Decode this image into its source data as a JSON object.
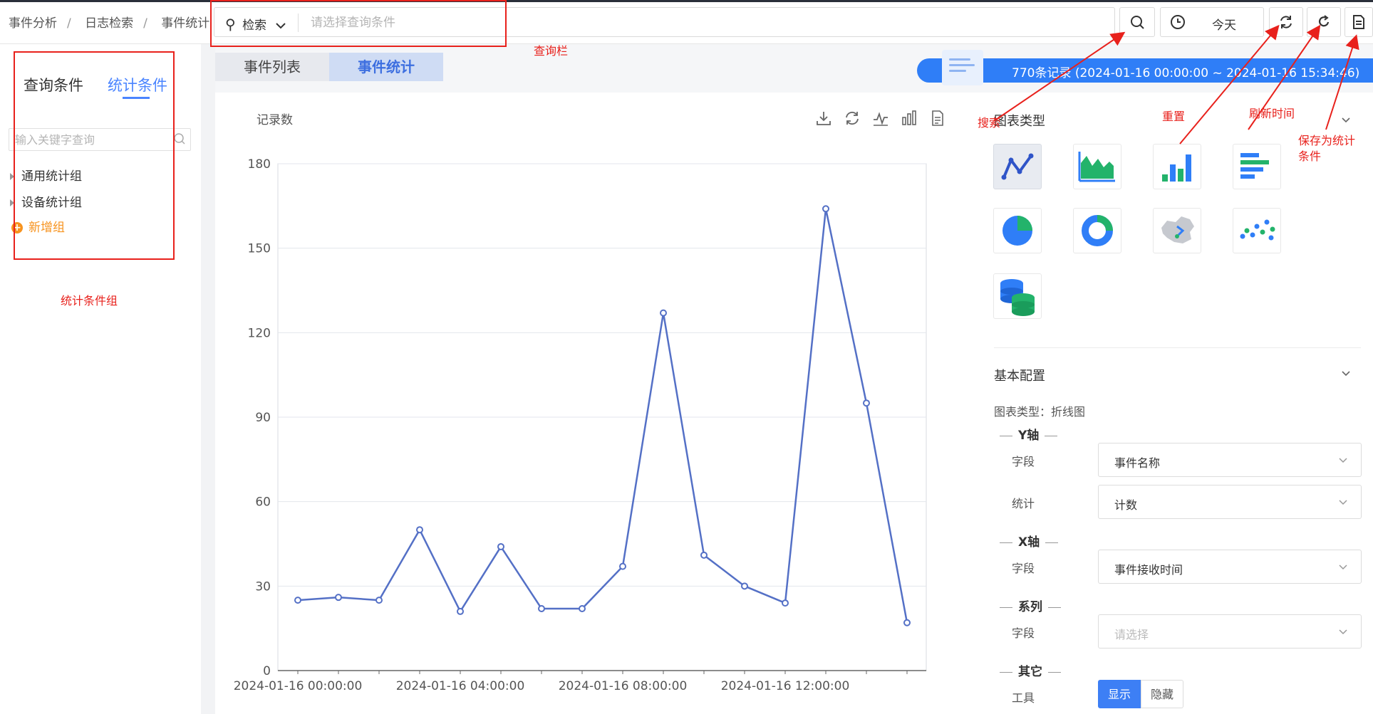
{
  "breadcrumb": [
    "事件分析",
    "日志检索",
    "事件统计"
  ],
  "search": {
    "type_label": "检索",
    "placeholder": "请选择查询条件"
  },
  "time_range": {
    "label": "今天"
  },
  "left_panel": {
    "tabs": [
      "查询条件",
      "统计条件"
    ],
    "active_tab": "统计条件",
    "search_placeholder": "输入关键字查询",
    "groups": [
      "通用统计组",
      "设备统计组"
    ],
    "add_group_label": "新增组"
  },
  "main_tabs": [
    "事件列表",
    "事件统计"
  ],
  "active_main_tab": "事件统计",
  "records_summary": "770条记录 (2024-01-16 00:00:00 ~ 2024-01-16 15:34:46)",
  "chart_panel": {
    "tools": [
      "download-icon",
      "refresh-icon",
      "line-chart-icon",
      "bar-chart-icon",
      "document-icon"
    ]
  },
  "chart_data": {
    "type": "line",
    "title": "",
    "ylabel": "记录数",
    "xlabel": "",
    "ylim": [
      0,
      180
    ],
    "yticks": [
      0,
      30,
      60,
      90,
      120,
      150,
      180
    ],
    "x": [
      "2024-01-16 00:00:00",
      "2024-01-16 01:00:00",
      "2024-01-16 02:00:00",
      "2024-01-16 03:00:00",
      "2024-01-16 04:00:00",
      "2024-01-16 05:00:00",
      "2024-01-16 06:00:00",
      "2024-01-16 07:00:00",
      "2024-01-16 08:00:00",
      "2024-01-16 09:00:00",
      "2024-01-16 10:00:00",
      "2024-01-16 11:00:00",
      "2024-01-16 12:00:00",
      "2024-01-16 13:00:00",
      "2024-01-16 14:00:00",
      "2024-01-16 15:00:00"
    ],
    "xtick_labels": [
      "2024-01-16 00:00:00",
      "2024-01-16 04:00:00",
      "2024-01-16 08:00:00",
      "2024-01-16 12:00:00"
    ],
    "series": [
      {
        "values": [
          25,
          26,
          25,
          50,
          21,
          44,
          22,
          22,
          37,
          127,
          41,
          30,
          24,
          164,
          95,
          17
        ]
      }
    ],
    "color": "#5470c6",
    "grid": true
  },
  "right_panel": {
    "chart_type_title": "图表类型",
    "chart_types": [
      {
        "name": "line-chart-type-icon",
        "selected": true
      },
      {
        "name": "area-chart-type-icon",
        "selected": false
      },
      {
        "name": "bar-chart-type-icon",
        "selected": false
      },
      {
        "name": "horizontal-bar-chart-type-icon",
        "selected": false
      },
      {
        "name": "pie-chart-type-icon",
        "selected": false
      },
      {
        "name": "donut-chart-type-icon",
        "selected": false
      },
      {
        "name": "map-chart-type-icon",
        "selected": false
      },
      {
        "name": "scatter-chart-type-icon",
        "selected": false
      },
      {
        "name": "database-chart-type-icon",
        "selected": false
      }
    ],
    "basic_config_title": "基本配置",
    "chart_type_line": "图表类型：折线图",
    "y_axis": {
      "title": "Y轴",
      "field_label": "字段",
      "field_value": "事件名称",
      "stat_label": "统计",
      "stat_value": "计数"
    },
    "x_axis": {
      "title": "X轴",
      "field_label": "字段",
      "field_value": "事件接收时间"
    },
    "series": {
      "title": "系列",
      "field_label": "字段",
      "field_placeholder": "请选择"
    },
    "other": {
      "title": "其它",
      "tool_label": "工具",
      "show_label": "显示",
      "hide_label": "隐藏",
      "show_selected": true
    }
  },
  "annotations": {
    "query_bar": "查询栏",
    "stat_group": "统计条件组",
    "search": "搜索",
    "reset": "重置",
    "refresh_time": "刷新时间",
    "save_as_stat": "保存为统计\n条件"
  },
  "colors": {
    "accent": "#4a84ff",
    "annotation": "#e8211c",
    "records_pill": "#2f7ef7",
    "add_group": "#f7931e"
  }
}
